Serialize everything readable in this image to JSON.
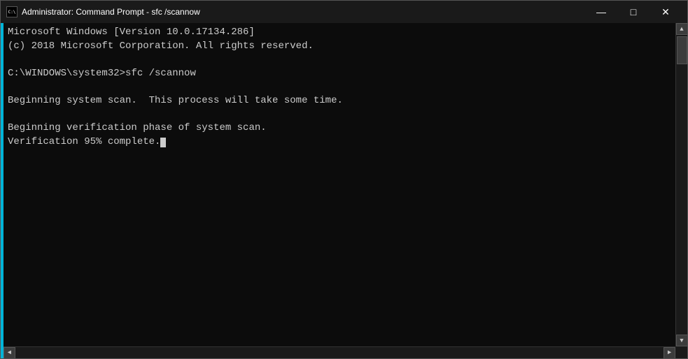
{
  "titleBar": {
    "icon": "cmd-icon",
    "title": "Administrator: Command Prompt - sfc /scannow",
    "minimizeLabel": "—",
    "maximizeLabel": "□",
    "closeLabel": "✕"
  },
  "terminal": {
    "lines": [
      "Microsoft Windows [Version 10.0.17134.286]",
      "(c) 2018 Microsoft Corporation. All rights reserved.",
      "",
      "C:\\WINDOWS\\system32>sfc /scannow",
      "",
      "Beginning system scan.  This process will take some time.",
      "",
      "Beginning verification phase of system scan.",
      "Verification 95% complete."
    ]
  },
  "scrollbar": {
    "upArrow": "▲",
    "downArrow": "▼",
    "leftArrow": "◄",
    "rightArrow": "►"
  }
}
